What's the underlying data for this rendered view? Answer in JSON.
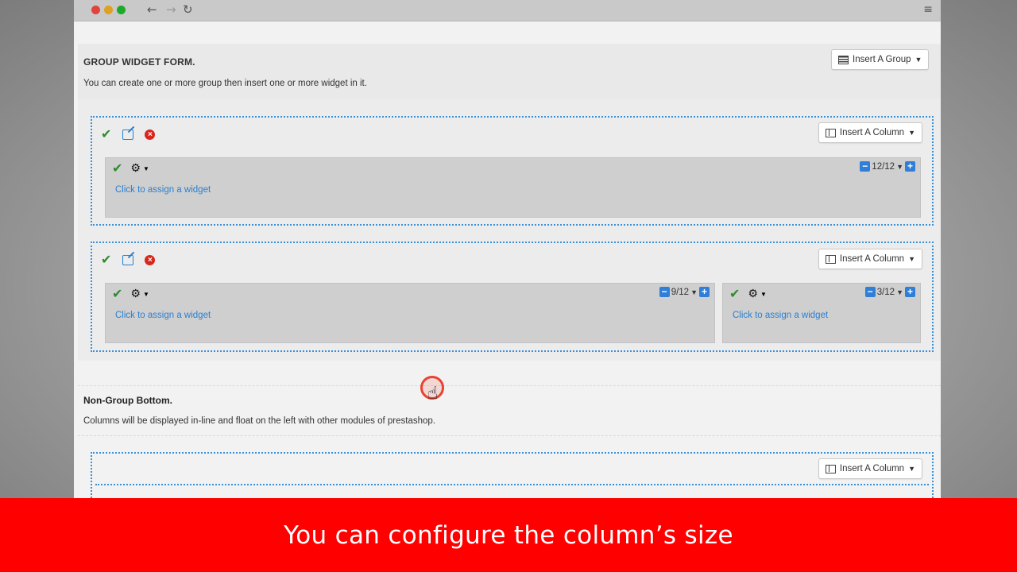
{
  "group_widget": {
    "title": "GROUP WIDGET FORM.",
    "description": "You can create one or more group then insert one or more widget in it.",
    "insert_group_label": "Insert A Group"
  },
  "groups": [
    {
      "insert_column_label": "Insert A Column",
      "columns": [
        {
          "size": "12/12",
          "assign_label": "Click to assign a widget"
        }
      ]
    },
    {
      "insert_column_label": "Insert A Column",
      "columns": [
        {
          "size": "9/12",
          "assign_label": "Click to assign a widget"
        },
        {
          "size": "3/12",
          "assign_label": "Click to assign a widget"
        }
      ]
    }
  ],
  "non_group_bottom": {
    "title": "Non-Group Bottom.",
    "description": "Columns will be displayed in-line and float on the left with other modules of prestashop.",
    "insert_column_label": "Insert A Column"
  },
  "caption": "You can configure the column’s size",
  "icons": {
    "check": "check-icon",
    "edit": "edit-icon",
    "remove": "remove-icon",
    "gear": "gear-icon",
    "minus": "minus-icon",
    "plus": "plus-icon"
  },
  "colors": {
    "caption_bg": "#ff0000",
    "link": "#2a7fd0",
    "dotted_border": "#3b8fd9",
    "check": "#2e8b2e",
    "remove": "#d9261c"
  }
}
